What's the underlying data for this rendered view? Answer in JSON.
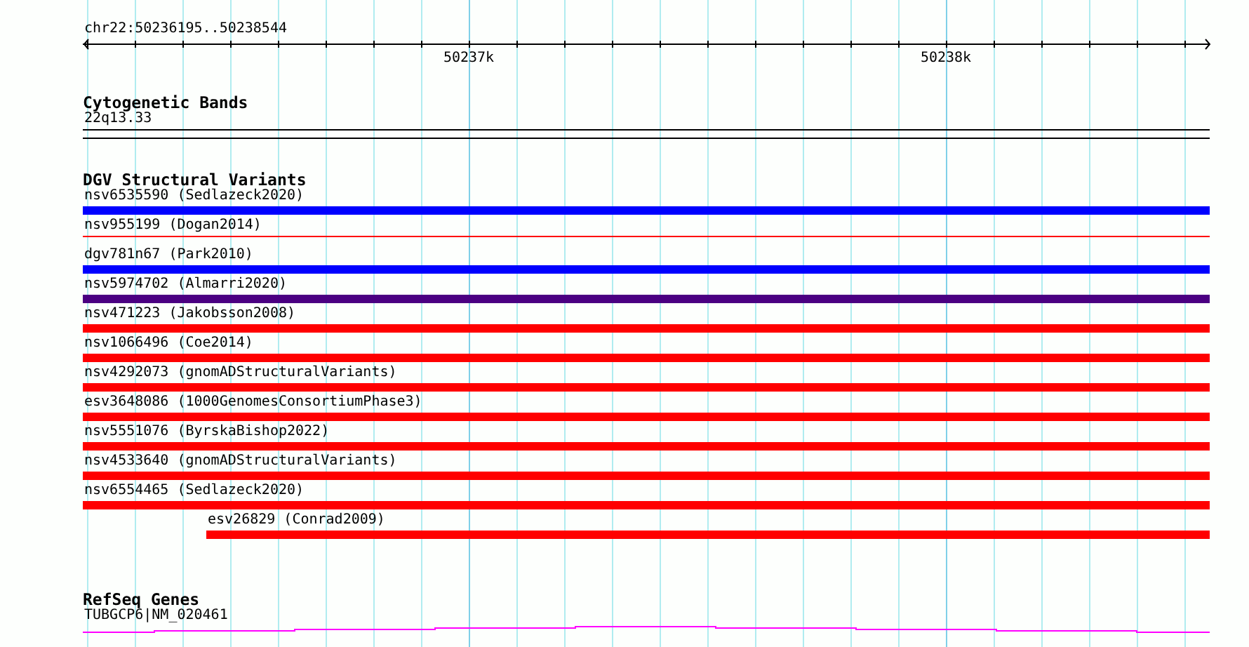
{
  "ruler": {
    "region": "chr22:50236195..50238544",
    "ticks": [
      {
        "label": "50237k"
      },
      {
        "label": "50238k"
      }
    ]
  },
  "tracks": [
    {
      "kind": "bands",
      "title": "Cytogenetic Bands",
      "features": [
        {
          "label": "22q13.33"
        }
      ]
    },
    {
      "kind": "variants",
      "title": "DGV Structural Variants",
      "features": [
        {
          "label": "nsv6535590 (Sedlazeck2020)",
          "kind": "thick",
          "color": "#0000ff"
        },
        {
          "label": "nsv955199 (Dogan2014)",
          "kind": "thin",
          "color": "#ff0000"
        },
        {
          "label": "dgv781n67 (Park2010)",
          "kind": "thick",
          "color": "#0000ff"
        },
        {
          "label": "nsv5974702 (Almarri2020)",
          "kind": "thick",
          "color": "#4b0082"
        },
        {
          "label": "nsv471223 (Jakobsson2008)",
          "kind": "thick",
          "color": "#ff0000"
        },
        {
          "label": "nsv1066496 (Coe2014)",
          "kind": "thick",
          "color": "#ff0000"
        },
        {
          "label": "nsv4292073 (gnomADStructuralVariants)",
          "kind": "thick",
          "color": "#ff0000"
        },
        {
          "label": "esv3648086 (1000GenomesConsortiumPhase3)",
          "kind": "thick",
          "color": "#ff0000"
        },
        {
          "label": "nsv5551076 (ByrskaBishop2022)",
          "kind": "thick",
          "color": "#ff0000"
        },
        {
          "label": "nsv4533640 (gnomADStructuralVariants)",
          "kind": "thick",
          "color": "#ff0000"
        },
        {
          "label": "nsv6554465 (Sedlazeck2020)",
          "kind": "thick",
          "color": "#ff0000"
        },
        {
          "label": "esv26829 (Conrad2009)",
          "kind": "partial",
          "color": "#ff0000"
        }
      ]
    },
    {
      "kind": "genes",
      "title": "RefSeq Genes",
      "features": [
        {
          "label": "TUBGCP6|NM_020461"
        }
      ]
    }
  ]
}
